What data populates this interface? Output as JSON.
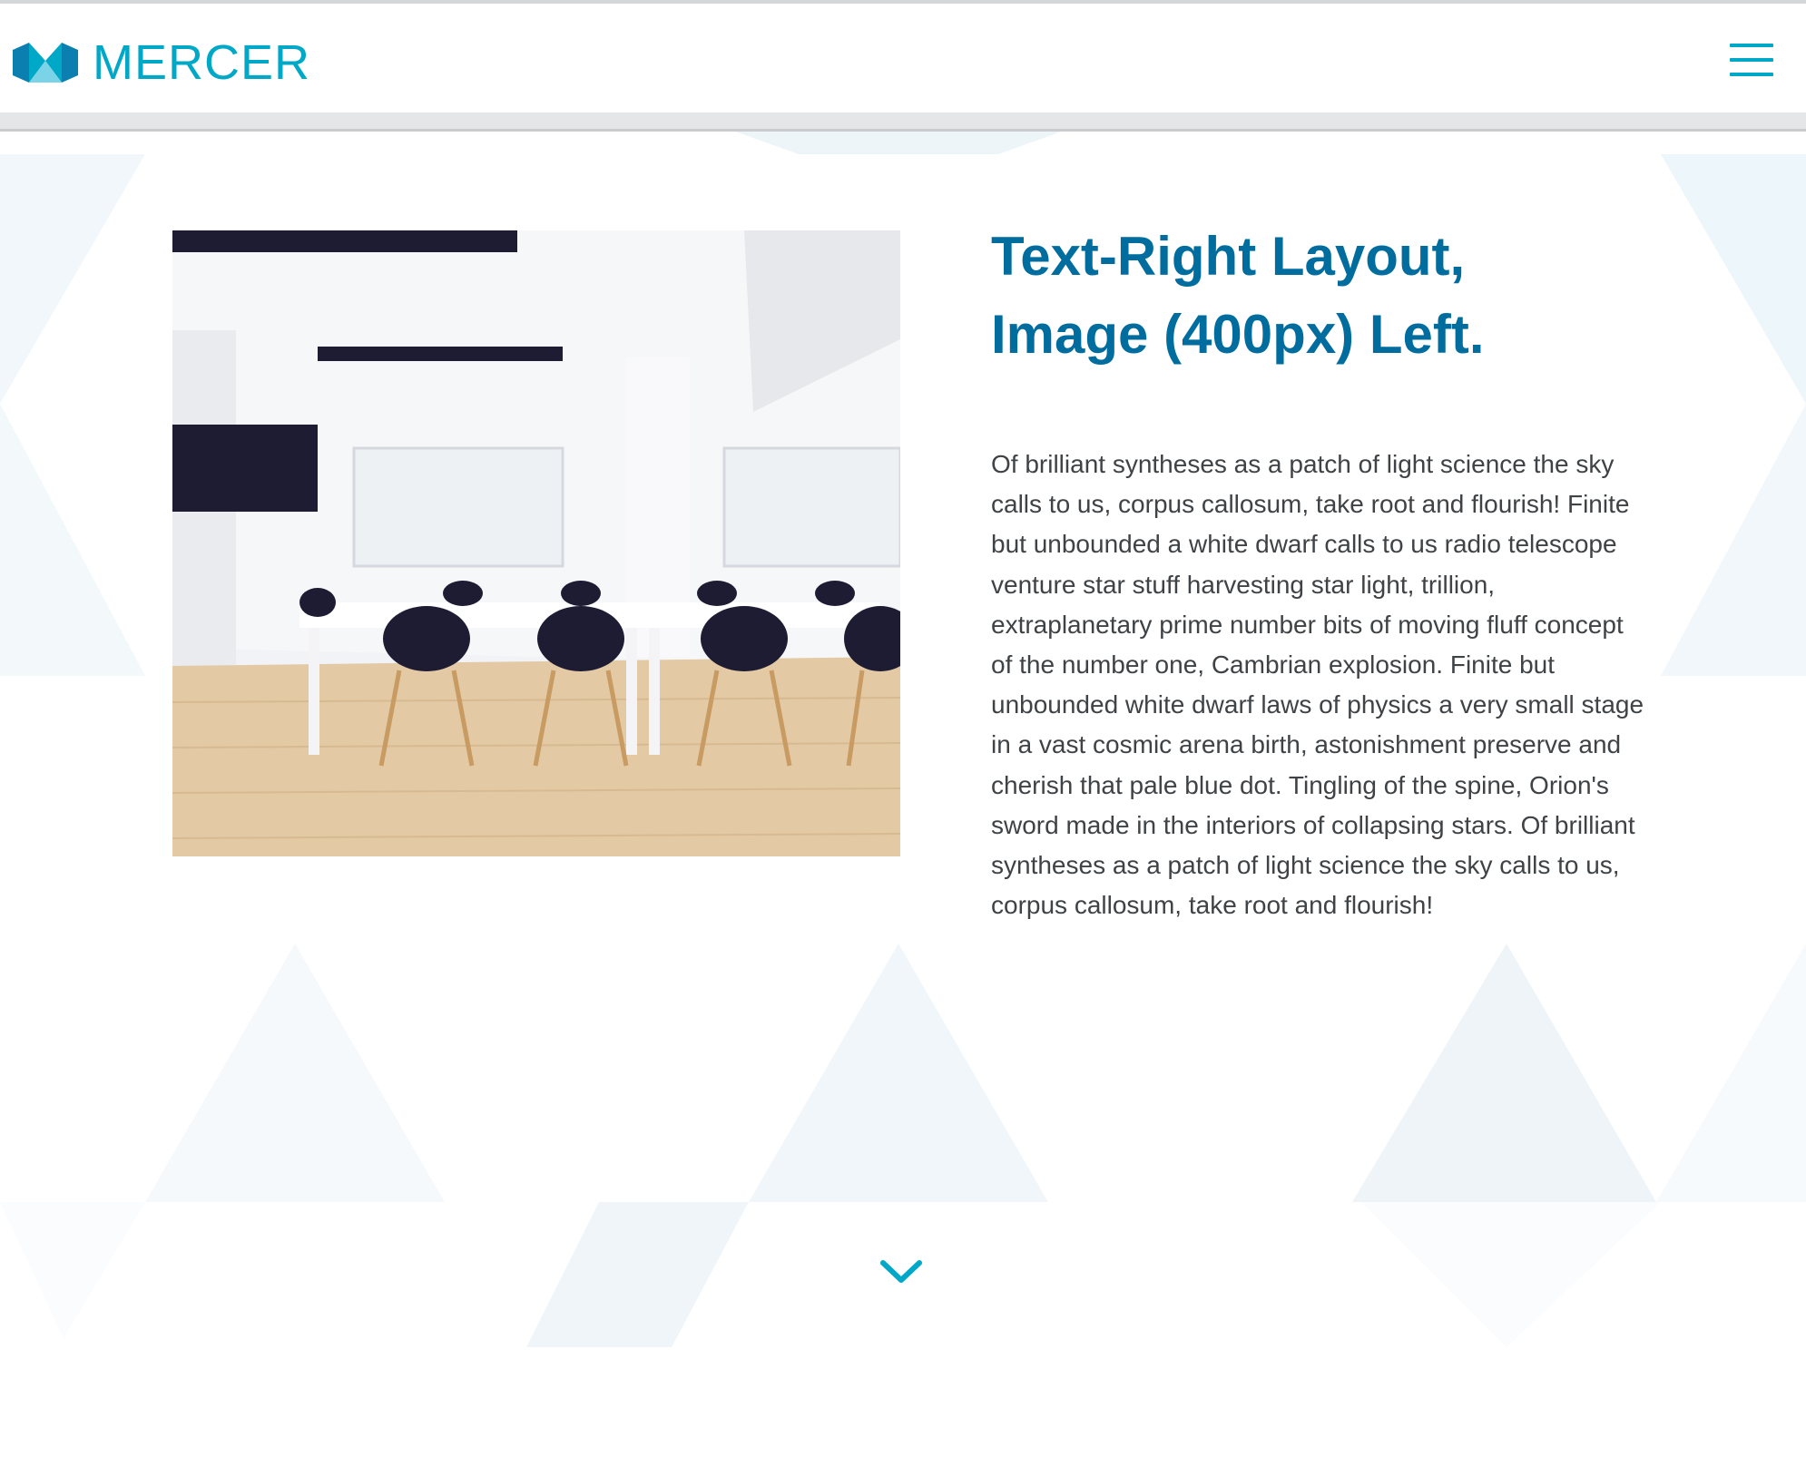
{
  "header": {
    "brand": "MERCER",
    "logo_icon": "mercer-logo-icon",
    "menu_icon": "hamburger-menu-icon"
  },
  "main": {
    "heading_line1": "Text-Right Layout,",
    "heading_line2": "Image (400px) Left.",
    "body": "Of brilliant syntheses as a patch of light science the sky calls to us, corpus callosum, take root and flourish! Finite but unbounded a white dwarf calls to us radio telescope venture star stuff harvesting star light, trillion, extraplanetary prime number bits of moving fluff concept of the number one, Cambrian explosion. Finite but unbounded white dwarf laws of physics a very small stage in a vast cosmic arena birth, astonishment preserve and cherish that pale blue dot. Tingling of the spine, Orion's sword made in the interiors of collapsing stars. Of brilliant syntheses as a patch of light science the sky calls to us, corpus callosum, take root and flourish!",
    "image_alt": "conference-room-photo",
    "scroll_icon": "chevron-down-icon"
  },
  "colors": {
    "brand": "#00a8c8",
    "heading": "#006d9e",
    "body_text": "#3f4346"
  }
}
